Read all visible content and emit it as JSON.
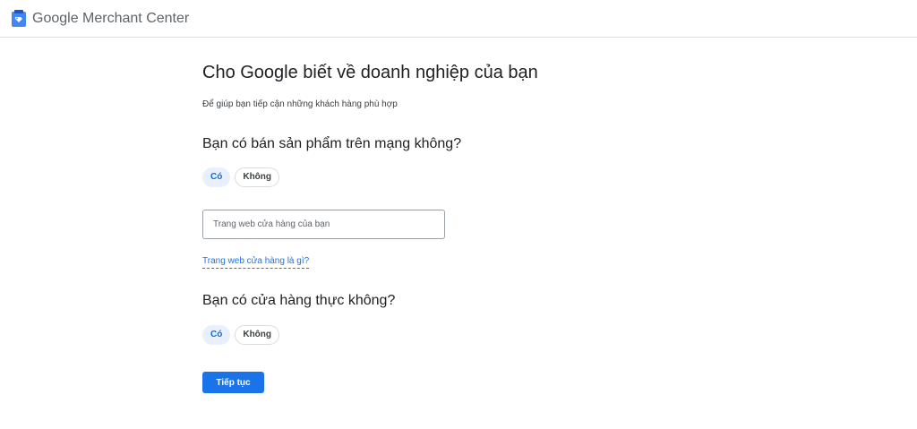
{
  "header": {
    "brand": "Google",
    "product": "Merchant Center",
    "logo_icon": "merchant-center-logo-icon",
    "colors": {
      "logo_blue": "#4285f4"
    }
  },
  "main": {
    "title": "Cho Google biết về doanh nghiệp của bạn",
    "subtitle": "Để giúp bạn tiếp cận những khách hàng phù hợp",
    "online_question": {
      "label": "Bạn có bán sản phẩm trên mạng không?",
      "options": [
        "Có",
        "Không"
      ],
      "selected": "Có"
    },
    "store_url": {
      "placeholder": "Trang web cửa hàng của bạn",
      "value": ""
    },
    "help_link": "Trang web cửa hàng là gì?",
    "physical_question": {
      "label": "Bạn có cửa hàng thực không?",
      "options": [
        "Có",
        "Không"
      ],
      "selected": "Có"
    },
    "continue_label": "Tiếp tục"
  },
  "colors": {
    "accent": "#1a73e8",
    "chip_selected_bg": "#e8f0fe",
    "chip_selected_text": "#1967d2"
  }
}
